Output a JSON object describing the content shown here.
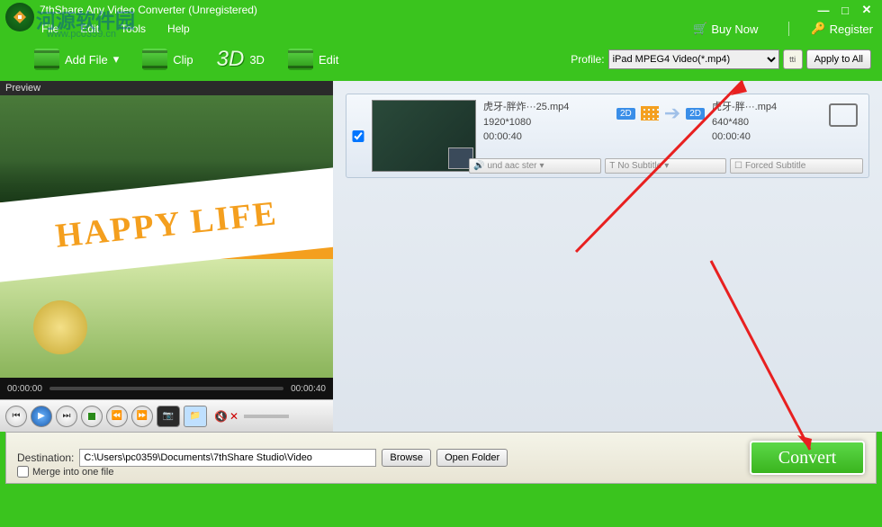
{
  "window": {
    "title": "7thShare Any Video Converter (Unregistered)"
  },
  "watermark": {
    "text": "河源软件园",
    "url": "www.pc0359.cn"
  },
  "menus": {
    "file": "File",
    "edit": "Edit",
    "tools": "Tools",
    "help": "Help"
  },
  "rightlinks": {
    "buy": "Buy Now",
    "register": "Register"
  },
  "toolbar": {
    "addfile": "Add File",
    "clip": "Clip",
    "td": "3D",
    "edit": "Edit",
    "profile_label": "Profile:",
    "profile_value": "iPad MPEG4 Video(*.mp4)",
    "apply": "Apply to All"
  },
  "preview": {
    "header": "Preview",
    "overlay": "HAPPY   LIFE",
    "time_cur": "00:00:00",
    "time_tot": "00:00:40"
  },
  "item": {
    "src": {
      "name": "虎牙-胖炸···25.mp4",
      "res": "1920*1080",
      "dur": "00:00:40"
    },
    "dst": {
      "name": "虎牙-胖···.mp4",
      "res": "640*480",
      "dur": "00:00:40"
    },
    "badge": "2D",
    "audio": "und aac ster",
    "subtitle": "No Subtitle",
    "forced": "Forced Subtitle"
  },
  "bottom": {
    "dest_label": "Destination:",
    "dest_path": "C:\\Users\\pc0359\\Documents\\7thShare Studio\\Video",
    "browse": "Browse",
    "open": "Open Folder",
    "merge": "Merge into one file",
    "convert": "Convert"
  }
}
